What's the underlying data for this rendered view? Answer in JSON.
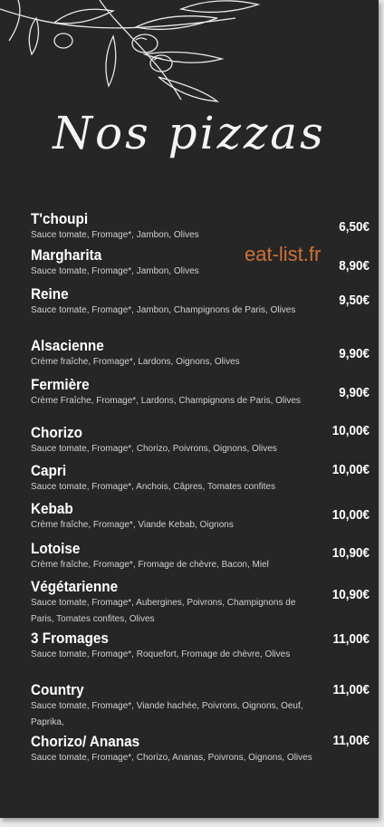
{
  "title": "Nos pizzas",
  "watermark": "eat-list.fr",
  "items": [
    {
      "name": "T'choupi",
      "desc": "Sauce tomate, Fromage*, Jambon, Olives",
      "price": "6,50€"
    },
    {
      "name": "Margharita",
      "desc": "Sauce tomate, Fromage*, Jambon, Olives",
      "price": "8,90€"
    },
    {
      "name": "Reine",
      "desc": "Sauce tomate, Fromage*, Jambon, Champignons de Paris, Olives",
      "price": "9,50€"
    },
    {
      "name": "Alsacienne",
      "desc": "Crème fraîche, Fromage*, Lardons, Oignons, Olives",
      "price": "9,90€"
    },
    {
      "name": "Fermière",
      "desc": "Crème Fraîche, Fromage*, Lardons, Champignons de Paris, Olives",
      "price": "9,90€"
    },
    {
      "name": "Chorizo",
      "desc": "Sauce tomate, Fromage*, Chorizo, Poivrons, Oignons, Olives",
      "price": "10,00€"
    },
    {
      "name": "Capri",
      "desc": "Sauce tomate, Fromage*, Anchois, Câpres, Tomates confites",
      "price": "10,00€"
    },
    {
      "name": "Kebab",
      "desc": "Crème fraîche, Fromage*, Viande Kebab, Oignons",
      "price": "10,00€"
    },
    {
      "name": "Lotoise",
      "desc": "Crème fraîche, Fromage*, Fromage de chèvre, Bacon, Miel",
      "price": "10,90€"
    },
    {
      "name": "Végétarienne",
      "desc": "Sauce tomate, Fromage*, Aubergines, Poivrons, Champignons de Paris, Tomates confites, Olives",
      "price": "10,90€"
    },
    {
      "name": "3 Fromages",
      "desc": "Sauce tomate, Fromage*, Roquefort, Fromage de chèvre, Olives",
      "price": "11,00€"
    },
    {
      "name": "Country",
      "desc": "Sauce tomate, Fromage*, Viande hachée, Poivrons, Oignons, Oeuf, Paprika,",
      "price": "11,00€"
    },
    {
      "name": "Chorizo/ Ananas",
      "desc": "Sauce tomate, Fromage*, Chorizo, Ananas, Poivrons, Oignons, Olives",
      "price": "11,00€"
    }
  ]
}
